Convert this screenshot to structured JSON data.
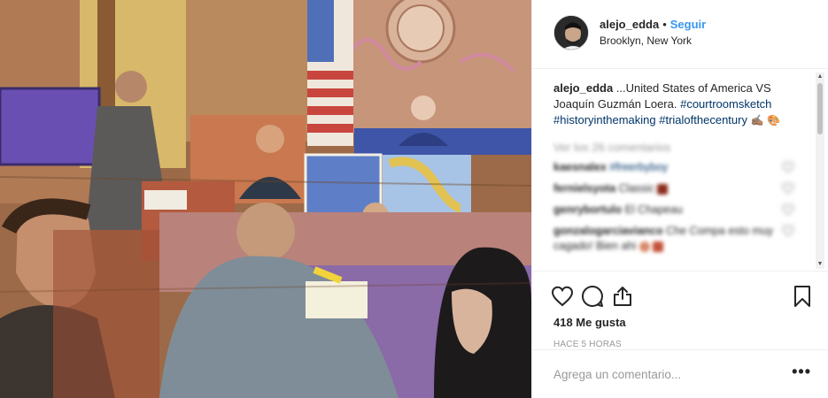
{
  "media": {
    "icon": "courtroom-sketch-image"
  },
  "header": {
    "username": "alejo_edda",
    "separator": "•",
    "follow_label": "Seguir",
    "location": "Brooklyn, New York"
  },
  "caption": {
    "username": "alejo_edda",
    "text": " ...United States of America VS Joaquín Guzmán Loera. ",
    "hashtags": [
      "#courtroomsketch",
      "#historyinthemaking",
      "#trialofthecentury"
    ],
    "emojis": [
      "✍🏽",
      "🎨"
    ]
  },
  "view_all_label": "Ver los 26 comentarios",
  "comments": [
    {
      "user": "kaesnalex",
      "text": "#freerbyboy"
    },
    {
      "user": "fernielsyota",
      "text": "Classic"
    },
    {
      "user": "genrybortulo",
      "text": "El Chapeau"
    },
    {
      "user": "gonzalogarciavianco",
      "text": "Che Compa esto muy cagado! Bien ahi"
    }
  ],
  "likes_label": "418 Me gusta",
  "time_label": "HACE 5 HORAS",
  "add_comment": {
    "placeholder": "Agrega un comentario...",
    "more_label": "•••"
  },
  "colors": {
    "link": "#003569",
    "follow": "#3897f0",
    "muted": "#999999"
  }
}
